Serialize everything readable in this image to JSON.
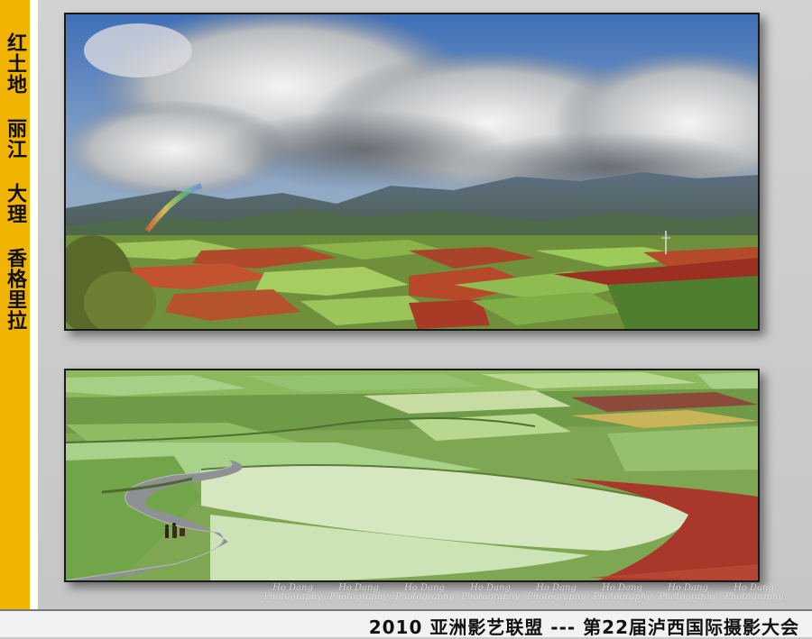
{
  "sidebar": {
    "title": "红土地 丽江 大理 香格里拉"
  },
  "watermark": {
    "text": "Ho Dang Photography",
    "repeats": 8
  },
  "footer": {
    "caption": "2010 亚洲影艺联盟 --- 第22届泸西国际摄影大会"
  },
  "colors": {
    "sidebar": "#f1b400",
    "background": "#c9c9c9",
    "footer_bg": "#f2f2f2"
  }
}
